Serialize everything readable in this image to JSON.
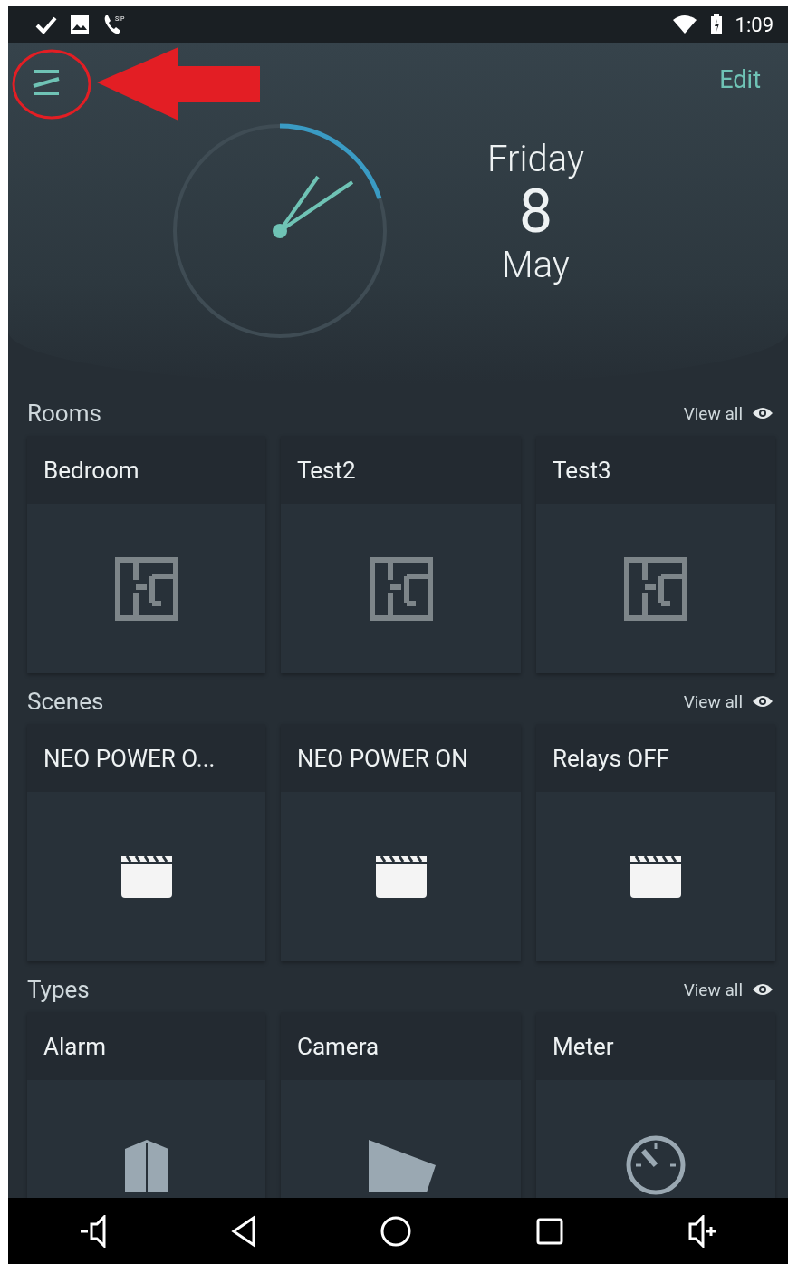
{
  "status_bar": {
    "time": "1:09",
    "call_label": "SIP"
  },
  "header": {
    "edit": "Edit",
    "day": "Friday",
    "date": "8",
    "month": "May"
  },
  "sections": [
    {
      "title": "Rooms",
      "view_all": "View all",
      "cards": [
        {
          "title": "Bedroom"
        },
        {
          "title": "Test2"
        },
        {
          "title": "Test3"
        }
      ]
    },
    {
      "title": "Scenes",
      "view_all": "View all",
      "cards": [
        {
          "title": "NEO POWER O..."
        },
        {
          "title": "NEO POWER ON"
        },
        {
          "title": "Relays OFF"
        }
      ]
    },
    {
      "title": "Types",
      "view_all": "View all",
      "cards": [
        {
          "title": "Alarm"
        },
        {
          "title": "Camera"
        },
        {
          "title": "Meter"
        }
      ]
    }
  ]
}
